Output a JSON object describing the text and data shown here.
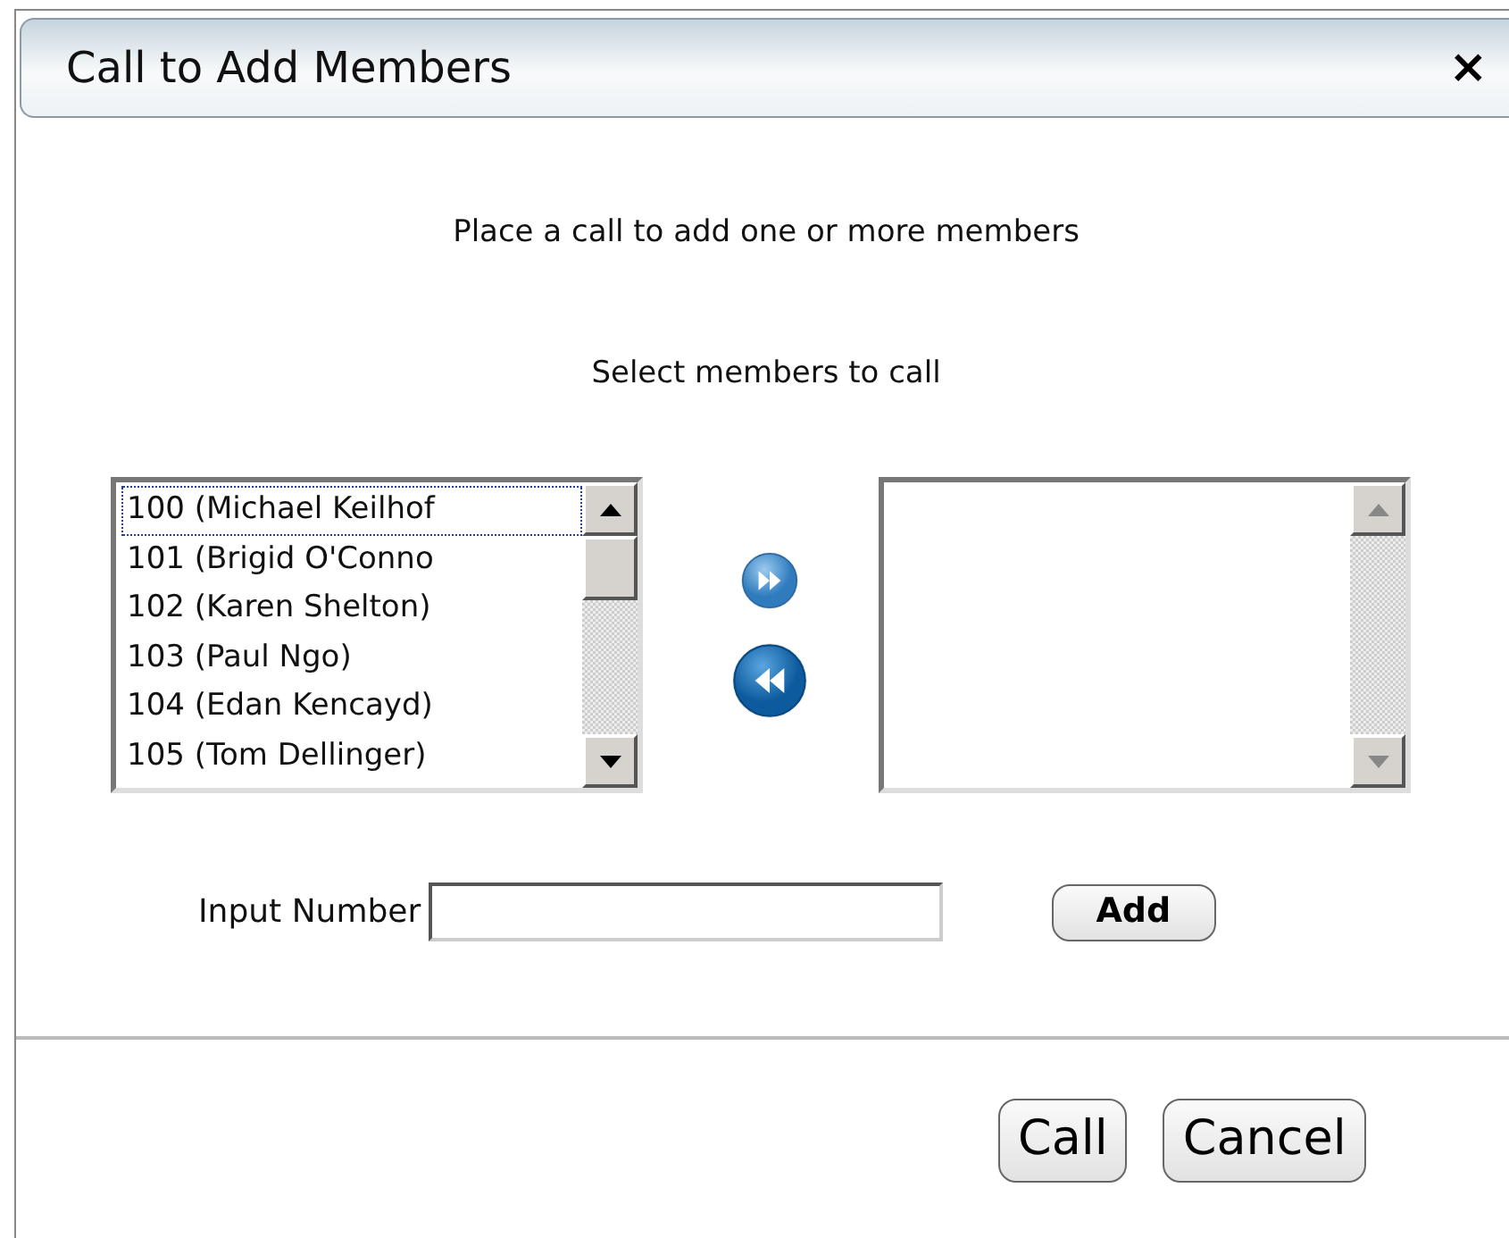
{
  "dialog": {
    "title": "Call to Add Members",
    "close": "×"
  },
  "intro": "Place a call to add one or more members",
  "prompt": "Select members to call",
  "available": [
    {
      "label": "100 (Michael Keilhof",
      "focused": true
    },
    {
      "label": "101 (Brigid O'Conno",
      "focused": false
    },
    {
      "label": "102 (Karen Shelton)",
      "focused": false
    },
    {
      "label": "103 (Paul Ngo)",
      "focused": false
    },
    {
      "label": "104 (Edan Kencayd)",
      "focused": false
    },
    {
      "label": "105 (Tom Dellinger)",
      "focused": false
    }
  ],
  "input": {
    "label": "Input Number"
  },
  "buttons": [
    {
      "label": "Add",
      "kind": "add"
    },
    {
      "label": "Call",
      "kind": "footer"
    },
    {
      "label": "Cancel",
      "kind": "footer"
    }
  ]
}
